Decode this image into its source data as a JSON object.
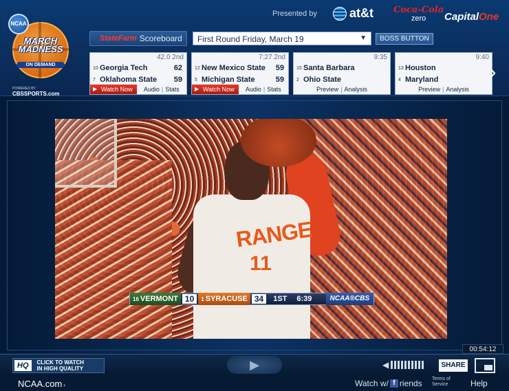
{
  "branding": {
    "ncaa_seal": "NCAA",
    "logo_line1": "MARCH",
    "logo_line2": "MADNESS",
    "logo_sub": "ON DEMAND",
    "powered_by": "POWERED BY",
    "cbs": "CBSSPORTS.com"
  },
  "sponsors": {
    "presented_by": "Presented by",
    "att": "at&t",
    "coke_line1": "Coca-Cola",
    "coke_line2": "zero",
    "capone_prefix": "Capital",
    "capone_suffix": "One"
  },
  "scoreboard": {
    "statefarm": "StateFarm",
    "title": "Scoreboard",
    "round_selected": "First Round Friday, March 19",
    "boss_button": "BOSS BUTTON",
    "games": [
      {
        "clock": "42.0  2nd",
        "team1": {
          "seed": "10",
          "name": "Georgia Tech",
          "score": "62"
        },
        "team2": {
          "seed": "7",
          "name": "Oklahoma State",
          "score": "59"
        },
        "watch": "Watch Now",
        "link1": "Audio",
        "link2": "Stats"
      },
      {
        "clock": "7:27  2nd",
        "team1": {
          "seed": "12",
          "name": "New Mexico State",
          "score": "59"
        },
        "team2": {
          "seed": "5",
          "name": "Michigan State",
          "score": "59"
        },
        "watch": "Watch Now",
        "link1": "Audio",
        "link2": "Stats"
      },
      {
        "clock": "9:35",
        "team1": {
          "seed": "15",
          "name": "Santa Barbara",
          "score": ""
        },
        "team2": {
          "seed": "2",
          "name": "Ohio State",
          "score": ""
        },
        "link1": "Preview",
        "link2": "Analysis"
      },
      {
        "clock": "9:40",
        "team1": {
          "seed": "13",
          "name": "Houston",
          "score": ""
        },
        "team2": {
          "seed": "4",
          "name": "Maryland",
          "score": ""
        },
        "link1": "Preview",
        "link2": "Analysis"
      }
    ]
  },
  "video": {
    "jersey_text": "RANGE",
    "jersey_number": "11",
    "score_bug": {
      "team1_seed": "16",
      "team1_name": "VERMONT",
      "team1_score": "10",
      "team2_seed": "1",
      "team2_name": "SYRACUSE",
      "team2_score": "34",
      "period": "1ST",
      "clock": "6:39",
      "network": "NCAA®CBS"
    },
    "elapsed": "00:54:12"
  },
  "controls": {
    "hq_badge": "HQ",
    "hq_line1": "CLICK TO WATCH",
    "hq_line2": "IN HIGH QUALITY",
    "share": "SHARE"
  },
  "footer": {
    "ncaa_link": "NCAA.com",
    "watch_with": "Watch w/",
    "friends": "riends",
    "terms_line1": "Terms of",
    "terms_line2": "Service",
    "help": "Help"
  },
  "colors": {
    "background": "#0b2748",
    "watch_now": "#e23b2e",
    "scoreboard_card": "#f3f5f8"
  }
}
